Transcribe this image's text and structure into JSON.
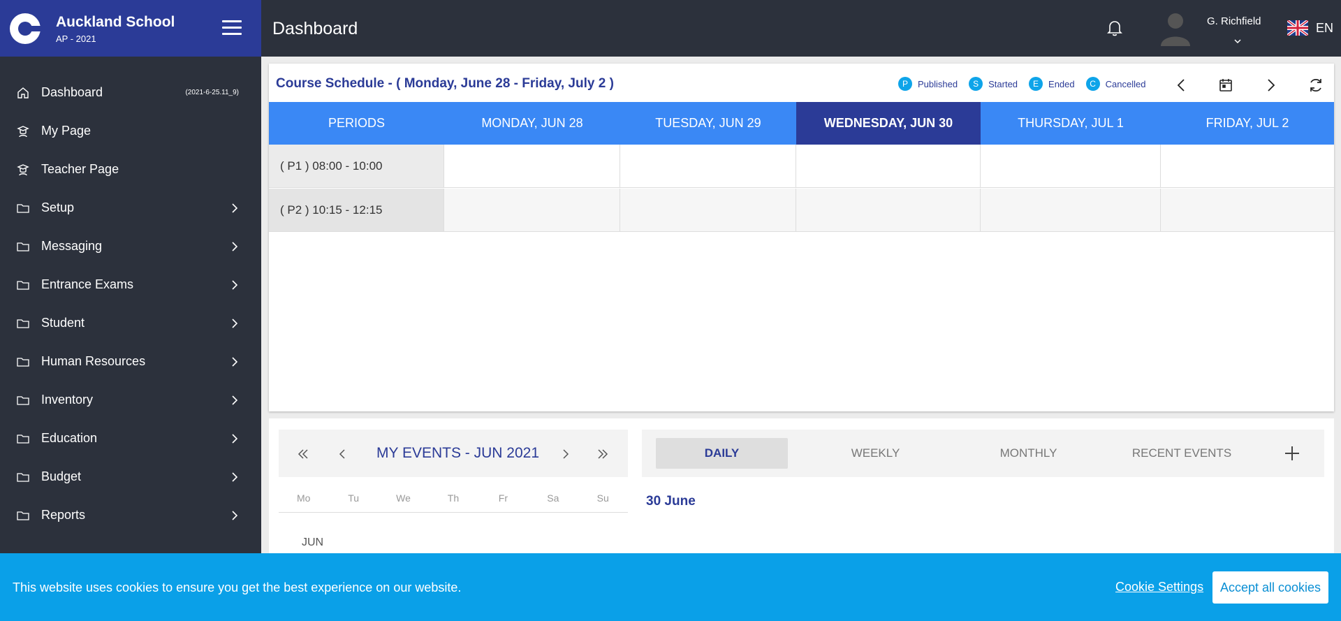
{
  "brand": {
    "title": "Auckland School",
    "subtitle": "AP - 2021"
  },
  "sidebar": {
    "items": [
      {
        "label": "Dashboard",
        "icon": "home-icon",
        "version": "(2021-6-25.11_9)"
      },
      {
        "label": "My Page",
        "icon": "user-icon"
      },
      {
        "label": "Teacher Page",
        "icon": "teacher-icon"
      },
      {
        "label": "Setup",
        "icon": "folder-icon"
      },
      {
        "label": "Messaging",
        "icon": "folder-icon"
      },
      {
        "label": "Entrance Exams",
        "icon": "folder-icon"
      },
      {
        "label": "Student",
        "icon": "folder-icon"
      },
      {
        "label": "Human Resources",
        "icon": "folder-icon"
      },
      {
        "label": "Inventory",
        "icon": "folder-icon"
      },
      {
        "label": "Education",
        "icon": "folder-icon"
      },
      {
        "label": "Budget",
        "icon": "folder-icon"
      },
      {
        "label": "Reports",
        "icon": "folder-icon"
      }
    ]
  },
  "header": {
    "title": "Dashboard",
    "user_name": "G. Richfield",
    "language": "EN"
  },
  "schedule": {
    "title": "Course Schedule - ( Monday, June 28 - Friday, July 2 )",
    "legend": [
      {
        "letter": "P",
        "label": "Published"
      },
      {
        "letter": "S",
        "label": "Started"
      },
      {
        "letter": "E",
        "label": "Ended"
      },
      {
        "letter": "C",
        "label": "Cancelled"
      }
    ],
    "columns": [
      "PERIODS",
      "MONDAY, JUN 28",
      "TUESDAY, JUN 29",
      "WEDNESDAY, JUN 30",
      "THURSDAY, JUL 1",
      "FRIDAY, JUL 2"
    ],
    "active_column": "WEDNESDAY, JUN 30",
    "periods": [
      "( P1 ) 08:00 - 10:00",
      "( P2 ) 10:15 - 12:15"
    ]
  },
  "events": {
    "calendar_title": "MY EVENTS - JUN 2021",
    "weekdays": [
      "Mo",
      "Tu",
      "We",
      "Th",
      "Fr",
      "Sa",
      "Su"
    ],
    "month_label": "JUN",
    "tabs": [
      "DAILY",
      "WEEKLY",
      "MONTHLY",
      "RECENT EVENTS"
    ],
    "active_tab": "DAILY",
    "selected_date": "30 June"
  },
  "cookie": {
    "text": "This website uses cookies to ensure you get the best experience on our website.",
    "settings_label": "Cookie Settings",
    "accept_label": "Accept all cookies"
  },
  "colors": {
    "sidebar_bg": "#2c313c",
    "brand_bg": "#2b3b97",
    "schedule_header": "#3a88f5",
    "schedule_active": "#2b3b97",
    "legend_dot": "#0ea4e9",
    "cookie_bg": "#0aa0e8"
  }
}
